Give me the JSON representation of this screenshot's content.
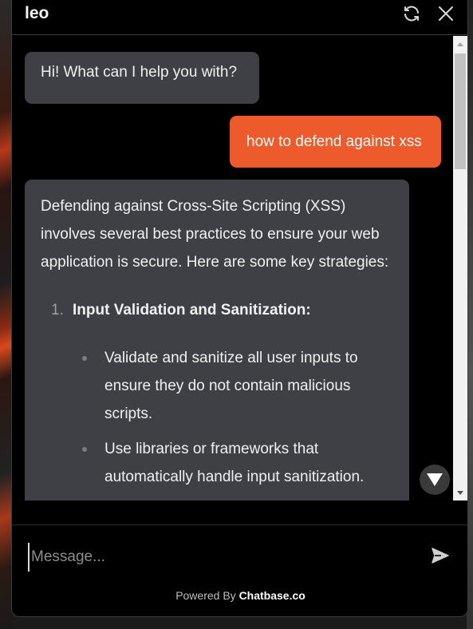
{
  "header": {
    "title": "leo",
    "refresh_icon": "refresh-icon",
    "close_icon": "close-icon"
  },
  "messages": [
    {
      "role": "bot",
      "text": "Hi! What can I help you with?"
    },
    {
      "role": "user",
      "text": "how to defend against xss"
    },
    {
      "role": "bot",
      "intro": "Defending against Cross-Site Scripting (XSS) involves several best practices to ensure your web application is secure. Here are some key strategies:",
      "list": [
        {
          "number": "1.",
          "title": "Input Validation and Sanitization:",
          "bullets": [
            "Validate and sanitize all user inputs to ensure they do not contain malicious scripts.",
            "Use libraries or frameworks that automatically handle input sanitization."
          ]
        }
      ]
    }
  ],
  "composer": {
    "placeholder": "Message...",
    "send_icon": "send-icon"
  },
  "footer": {
    "prefix": "Powered By",
    "brand": "Chatbase.co"
  },
  "colors": {
    "accent": "#ed5a2c",
    "bot_bubble": "#3f4045",
    "background": "#000000"
  }
}
